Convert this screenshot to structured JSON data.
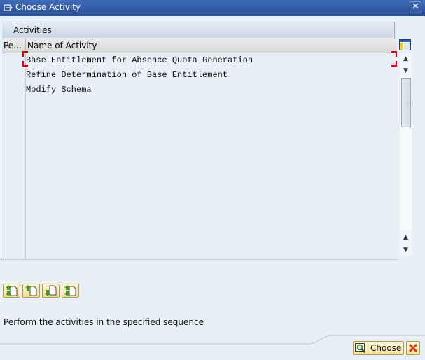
{
  "window": {
    "title": "Choose Activity",
    "title_icon": "dialog-icon",
    "close_icon": "close-icon"
  },
  "panel": {
    "title": "Activities",
    "columns": [
      "Pe...",
      "Name of Activity"
    ],
    "rows": [
      {
        "perform": "",
        "name": "Base Entitlement for Absence Quota Generation"
      },
      {
        "perform": "",
        "name": "Refine Determination of Base Entitlement"
      },
      {
        "perform": "",
        "name": "Modify Schema"
      },
      {
        "perform": "",
        "name": ""
      },
      {
        "perform": "",
        "name": ""
      },
      {
        "perform": "",
        "name": ""
      },
      {
        "perform": "",
        "name": ""
      },
      {
        "perform": "",
        "name": ""
      },
      {
        "perform": "",
        "name": ""
      },
      {
        "perform": "",
        "name": ""
      },
      {
        "perform": "",
        "name": ""
      },
      {
        "perform": "",
        "name": ""
      },
      {
        "perform": "",
        "name": ""
      },
      {
        "perform": "",
        "name": ""
      }
    ],
    "selected_row": 0
  },
  "toolbar": {
    "buttons": [
      {
        "name": "move-first-button",
        "icon": "move-first-icon"
      },
      {
        "name": "move-up-button",
        "icon": "move-up-icon"
      },
      {
        "name": "move-down-button",
        "icon": "move-down-icon"
      },
      {
        "name": "move-last-button",
        "icon": "move-last-icon"
      }
    ]
  },
  "hint": "Perform the activities in the specified sequence",
  "footer": {
    "choose_label": "Choose",
    "cancel_icon": "cancel-icon"
  },
  "colors": {
    "title_bar": "#2f58a4",
    "background": "#e8eff7",
    "button_bg": "#f6e39a",
    "focus_marker": "#dd0000"
  }
}
